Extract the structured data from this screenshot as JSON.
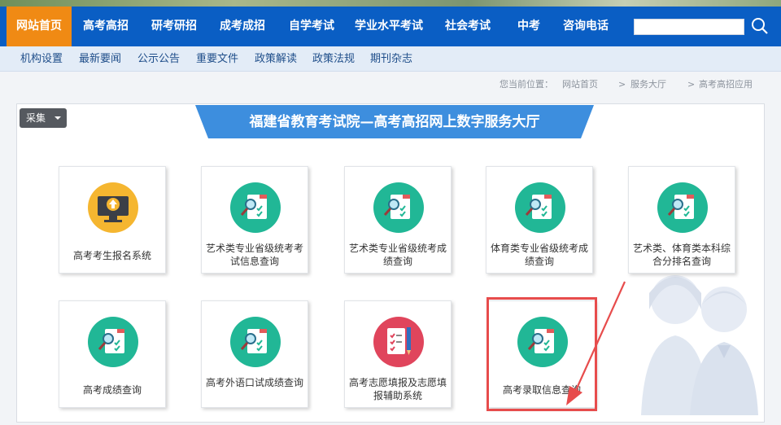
{
  "nav": {
    "items": [
      "网站首页",
      "高考高招",
      "研考研招",
      "成考成招",
      "自学考试",
      "学业水平考试",
      "社会考试",
      "中考",
      "咨询电话"
    ],
    "active_index": 0,
    "search_value": "",
    "colors": {
      "bar": "#0a5ec4",
      "active": "#f08a14"
    }
  },
  "subnav": {
    "items": [
      "机构设置",
      "最新要闻",
      "公示公告",
      "重要文件",
      "政策解读",
      "政策法规",
      "期刊杂志"
    ]
  },
  "breadcrumb": {
    "prefix": "您当前位置：",
    "items": [
      "网站首页",
      "服务大厅",
      "高考高招应用"
    ],
    "separator": ">"
  },
  "collect_button": "采集",
  "banner": {
    "title": "福建省教育考试院—高考高招网上数字服务大厅",
    "color": "#3d8ede"
  },
  "cards": [
    {
      "label": "高考考生报名系统",
      "icon": "computer-upload-icon"
    },
    {
      "label": "艺术类专业省级统考考试信息查询",
      "icon": "report-search-icon"
    },
    {
      "label": "艺术类专业省级统考成绩查询",
      "icon": "report-search-icon"
    },
    {
      "label": "体育类专业省级统考成绩查询",
      "icon": "report-search-icon"
    },
    {
      "label": "艺术类、体育类本科综合分排名查询",
      "icon": "report-search-icon"
    },
    {
      "label": "高考成绩查询",
      "icon": "report-search-icon"
    },
    {
      "label": "高考外语口试成绩查询",
      "icon": "report-search-icon"
    },
    {
      "label": "高考志愿填报及志愿填报辅助系统",
      "icon": "checklist-pencil-icon"
    },
    {
      "label": "高考录取信息查询",
      "icon": "report-search-icon"
    }
  ],
  "highlight_color": "#e74c4c"
}
